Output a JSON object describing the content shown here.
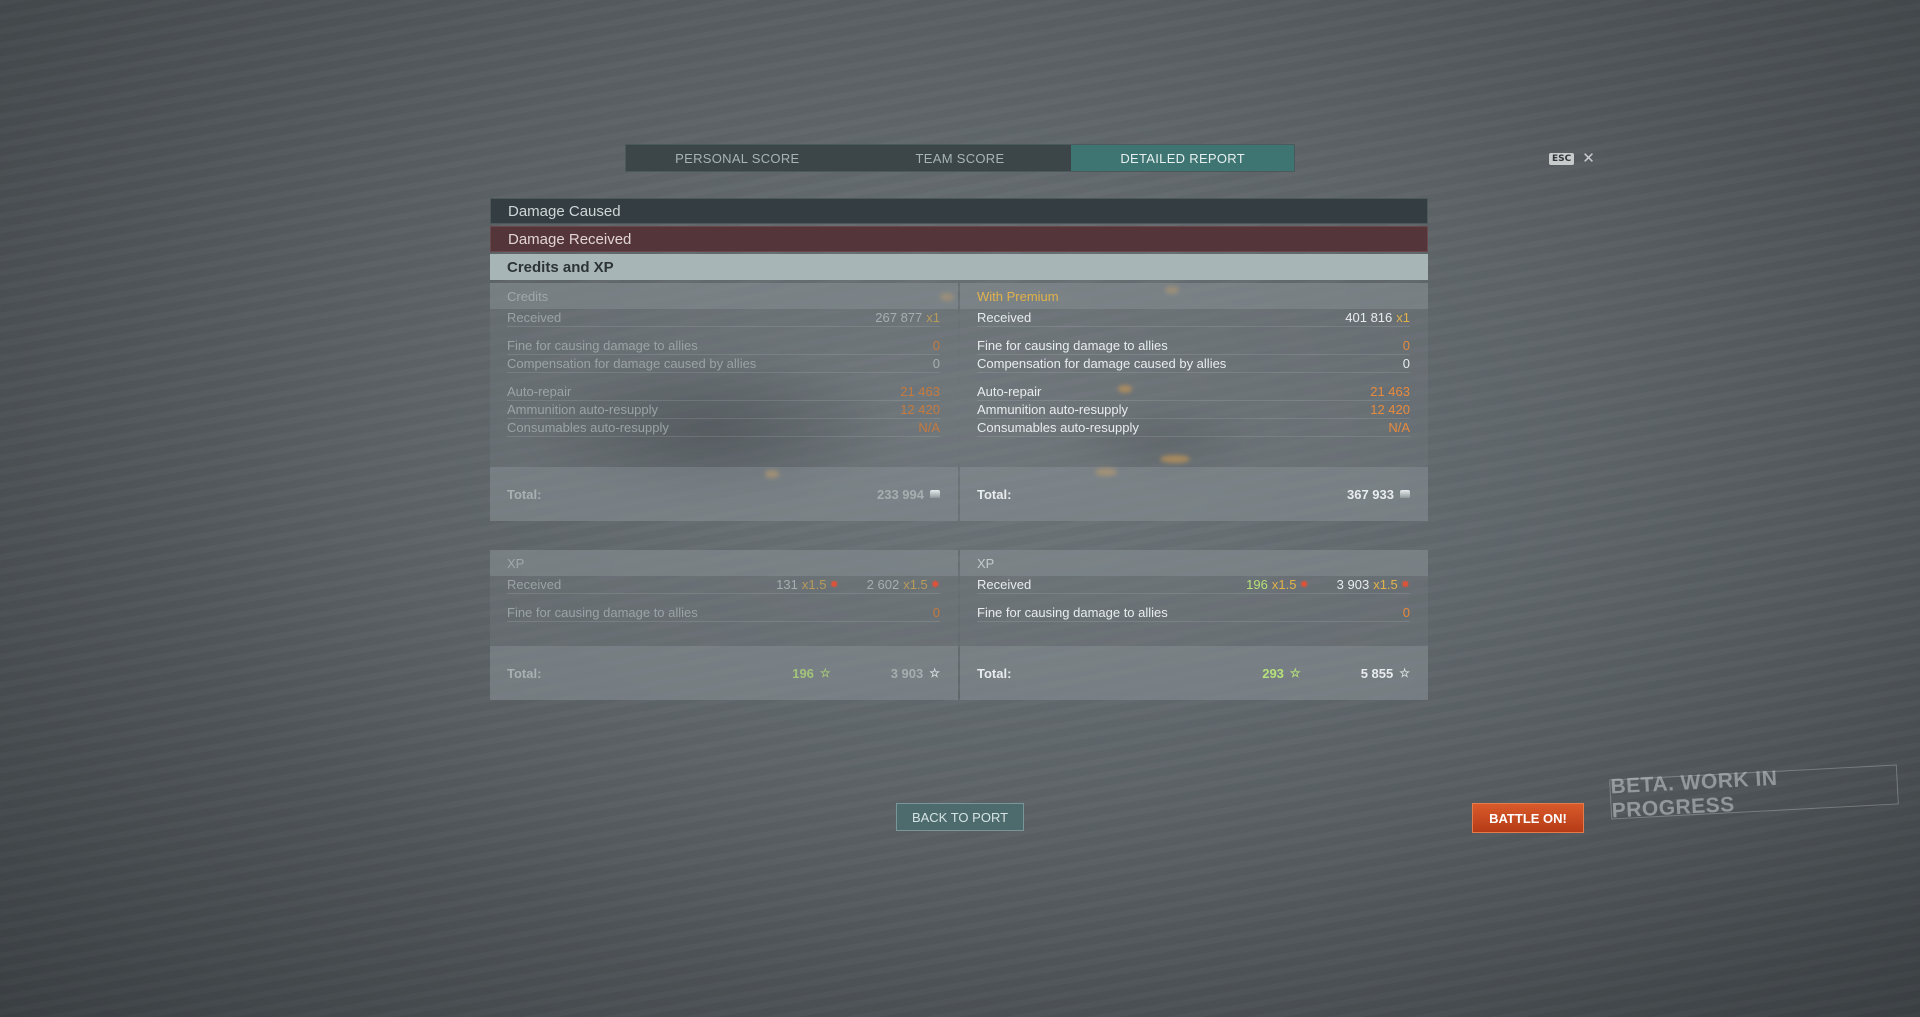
{
  "tabs": [
    {
      "label": "PERSONAL SCORE"
    },
    {
      "label": "TEAM SCORE"
    },
    {
      "label": "DETAILED REPORT"
    }
  ],
  "esc": {
    "key": "ESC",
    "close": "✕"
  },
  "sections": {
    "damage_caused": "Damage Caused",
    "damage_received": "Damage Received",
    "credits_xp": "Credits and XP"
  },
  "credits": {
    "header": "Credits",
    "received_label": "Received",
    "received_value": "267 877",
    "received_mult": "x1",
    "fine_label": "Fine for causing damage to allies",
    "fine_value": "0",
    "comp_label": "Compensation for damage caused by allies",
    "comp_value": "0",
    "repair_label": "Auto-repair",
    "repair_value": "21 463",
    "ammo_label": "Ammunition auto-resupply",
    "ammo_value": "12 420",
    "consumables_label": "Consumables auto-resupply",
    "consumables_value": "N/A",
    "total_label": "Total:",
    "total_value": "233 994"
  },
  "premium": {
    "header": "With Premium",
    "received_label": "Received",
    "received_value": "401 816",
    "received_mult": "x1",
    "fine_label": "Fine for causing damage to allies",
    "fine_value": "0",
    "comp_label": "Compensation for damage caused by allies",
    "comp_value": "0",
    "repair_label": "Auto-repair",
    "repair_value": "21 463",
    "ammo_label": "Ammunition auto-resupply",
    "ammo_value": "12 420",
    "consumables_label": "Consumables auto-resupply",
    "consumables_value": "N/A",
    "total_label": "Total:",
    "total_value": "367 933"
  },
  "xp": {
    "header": "XP",
    "received_label": "Received",
    "ship_xp": "131",
    "ship_mult": "x1.5",
    "account_xp": "2 602",
    "account_mult": "x1.5",
    "fine_label": "Fine for causing damage to allies",
    "fine_value": "0",
    "total_label": "Total:",
    "total_ship": "196",
    "total_account": "3 903"
  },
  "xp_premium": {
    "header": "XP",
    "received_label": "Received",
    "ship_xp": "196",
    "ship_mult": "x1.5",
    "account_xp": "3 903",
    "account_mult": "x1.5",
    "fine_label": "Fine for causing damage to allies",
    "fine_value": "0",
    "total_label": "Total:",
    "total_ship": "293",
    "total_account": "5 855"
  },
  "buttons": {
    "back": "BACK TO PORT",
    "battle": "BATTLE ON!"
  },
  "watermark": "BETA. WORK IN PROGRESS",
  "icons": {
    "star": "☆",
    "badge": "✸"
  },
  "colors": {
    "accent_tab": "#3e7472",
    "battle": "#c4461e",
    "premium": "#e2b24a",
    "penalty": "#e88a3c",
    "xp_green": "#b5e07a"
  }
}
